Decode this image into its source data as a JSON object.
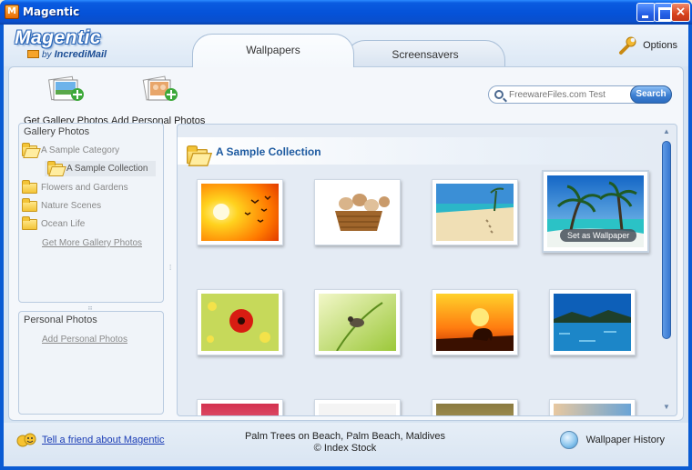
{
  "window": {
    "title": "Magentic",
    "app_icon_letter": "M"
  },
  "logo": {
    "name": "Magentic",
    "by": "by",
    "brand": "IncrediMail"
  },
  "tabs": [
    {
      "label": "Wallpapers",
      "active": true
    },
    {
      "label": "Screensavers",
      "active": false
    }
  ],
  "options_label": "Options",
  "toolbar": {
    "get_gallery": "Get Gallery Photos",
    "add_personal": "Add Personal Photos"
  },
  "search": {
    "placeholder": "FreewareFiles.com Test",
    "button": "Search"
  },
  "sidebar": {
    "gallery_title": "Gallery Photos",
    "categories": [
      {
        "label": "A Sample Category",
        "open": true
      },
      {
        "label": "A Sample Collection",
        "selected": true
      },
      {
        "label": "Flowers and Gardens"
      },
      {
        "label": "Nature Scenes"
      },
      {
        "label": "Ocean Life"
      }
    ],
    "get_more": "Get More Gallery Photos",
    "personal_title": "Personal Photos",
    "add_personal": "Add Personal Photos"
  },
  "gallery": {
    "collection_title": "A Sample Collection",
    "set_wallpaper": "Set as Wallpaper",
    "thumbnails": [
      {
        "subject": "sunset-birds"
      },
      {
        "subject": "puppies-basket"
      },
      {
        "subject": "beach-footprints"
      },
      {
        "subject": "palm-trees-beach",
        "hovered": true
      },
      {
        "subject": "red-poppy"
      },
      {
        "subject": "bird-on-grass"
      },
      {
        "subject": "elephant-sunset"
      },
      {
        "subject": "lake-reflection"
      }
    ]
  },
  "footer": {
    "tell_friend": "Tell a friend about Magentic",
    "caption_line1": "Palm Trees on Beach, Palm Beach, Maldives",
    "caption_line2": "© Index Stock",
    "history": "Wallpaper History"
  },
  "colors": {
    "titlebar": "#0a5be0",
    "accent": "#1d5aa0",
    "link": "#1a3cb5"
  }
}
